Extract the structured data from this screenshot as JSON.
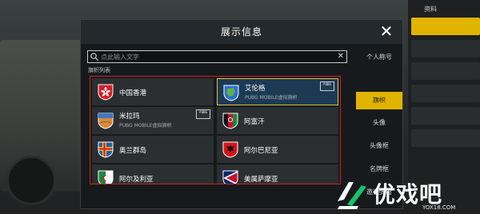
{
  "dialog": {
    "title": "展示信息",
    "close_symbol": "✕"
  },
  "search": {
    "placeholder": "点此输入文字",
    "value": "",
    "clear_symbol": "✕"
  },
  "flag_list": {
    "title": "旗帜列表",
    "items": [
      {
        "name": "中国香港",
        "subtitle": "",
        "selected": false,
        "pubg_tag": false,
        "icon": "hong-kong-flag-icon"
      },
      {
        "name": "艾伦格",
        "subtitle": "PUBG MOBILE虚拟旗帜",
        "selected": true,
        "pubg_tag": true,
        "pubg_tag_text": "PUBG",
        "icon": "erangel-flag-icon"
      },
      {
        "name": "米拉玛",
        "subtitle": "PUBG MOBILE虚拟旗帜",
        "selected": false,
        "pubg_tag": true,
        "pubg_tag_text": "PUBG",
        "icon": "miramar-flag-icon"
      },
      {
        "name": "阿富汗",
        "subtitle": "",
        "selected": false,
        "pubg_tag": false,
        "icon": "afghanistan-flag-icon"
      },
      {
        "name": "奥兰群岛",
        "subtitle": "",
        "selected": false,
        "pubg_tag": false,
        "icon": "aland-flag-icon"
      },
      {
        "name": "阿尔巴尼亚",
        "subtitle": "",
        "selected": false,
        "pubg_tag": false,
        "icon": "albania-flag-icon"
      },
      {
        "name": "阿尔及利亚",
        "subtitle": "",
        "selected": false,
        "pubg_tag": false,
        "icon": "algeria-flag-icon"
      },
      {
        "name": "美属萨摩亚",
        "subtitle": "",
        "selected": false,
        "pubg_tag": false,
        "icon": "american-samoa-flag-icon"
      }
    ]
  },
  "tabs": [
    {
      "label": "个人称号",
      "active": false
    },
    {
      "label": "旗帜",
      "active": true
    },
    {
      "label": "头像",
      "active": false
    },
    {
      "label": "头像框",
      "active": false
    },
    {
      "label": "名牌框",
      "active": false
    },
    {
      "label": "邀请弹窗",
      "active": false
    }
  ],
  "background": {
    "right_rail_label": "资料"
  },
  "watermark": {
    "brand": "优戏吧",
    "url": "YOX18.COM"
  },
  "colors": {
    "accent": "#e0b400",
    "selected_border": "#e6c23a",
    "highlight_box": "#d42020",
    "watermark_green": "#19c06a"
  }
}
